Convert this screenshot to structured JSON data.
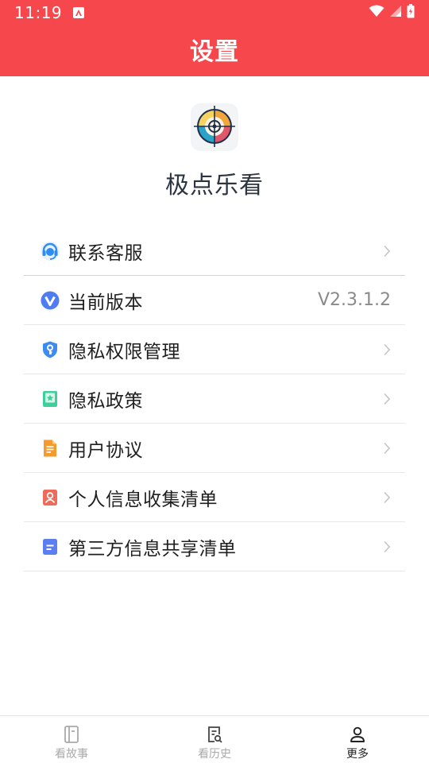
{
  "status_bar": {
    "time": "11:19"
  },
  "header": {
    "title": "设置"
  },
  "app": {
    "name": "极点乐看"
  },
  "menu": {
    "items": [
      {
        "label": "联系客服",
        "icon": "headset-icon",
        "value": ""
      },
      {
        "label": "当前版本",
        "icon": "version-icon",
        "value": "V2.3.1.2"
      },
      {
        "label": "隐私权限管理",
        "icon": "shield-key-icon",
        "value": ""
      },
      {
        "label": "隐私政策",
        "icon": "bookmark-star-icon",
        "value": ""
      },
      {
        "label": "用户协议",
        "icon": "document-icon",
        "value": ""
      },
      {
        "label": "个人信息收集清单",
        "icon": "user-card-icon",
        "value": ""
      },
      {
        "label": "第三方信息共享清单",
        "icon": "list-doc-icon",
        "value": ""
      }
    ]
  },
  "bottom_nav": {
    "items": [
      {
        "label": "看故事",
        "icon": "book-icon",
        "active": false
      },
      {
        "label": "看历史",
        "icon": "history-doc-icon",
        "active": false
      },
      {
        "label": "更多",
        "icon": "person-icon",
        "active": true
      }
    ]
  },
  "colors": {
    "header_bg": "#f5474c",
    "active_tab": "#222222",
    "inactive_tab": "#a9a9a9"
  }
}
